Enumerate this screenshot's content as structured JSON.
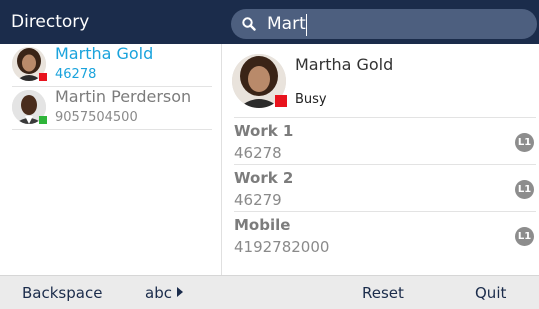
{
  "header": {
    "title": "Directory",
    "search": {
      "value": "Mart",
      "icon": "search-icon"
    }
  },
  "results": [
    {
      "name": "Martha Gold",
      "number": "46278",
      "status_color": "#e8131d",
      "selected": true,
      "name_color": "#1aa3dc",
      "number_color": "#1aa3dc"
    },
    {
      "name": "Martin Perderson",
      "number": "9057504500",
      "status_color": "#2fb53a",
      "selected": false,
      "name_color": "#7c7c7c",
      "number_color": "#8a8a8a"
    }
  ],
  "detail": {
    "name": "Martha Gold",
    "status": "Busy",
    "status_color": "#e8131d",
    "phones": [
      {
        "label": "Work 1",
        "number": "46278",
        "line": "L1"
      },
      {
        "label": "Work 2",
        "number": "46279",
        "line": "L1"
      },
      {
        "label": "Mobile",
        "number": "4192782000",
        "line": "L1"
      }
    ]
  },
  "softkeys": {
    "backspace": "Backspace",
    "abc": "abc",
    "reset": "Reset",
    "quit": "Quit"
  },
  "colors": {
    "header_bg": "#1b2c4b",
    "search_bg": "#4d5f7f",
    "accent": "#1aa3dc",
    "busy": "#e8131d",
    "available": "#2fb53a"
  }
}
